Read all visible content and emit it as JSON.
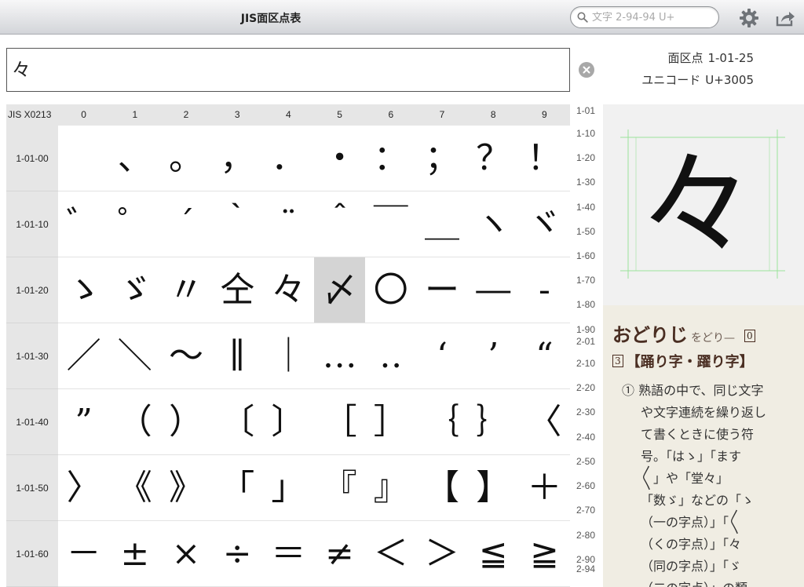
{
  "app": {
    "title": "JIS面区点表"
  },
  "search": {
    "placeholder": "文字 2-94-94 U+"
  },
  "toolbar": {
    "settings_icon": "gear-icon",
    "share_icon": "share-icon"
  },
  "input": {
    "value": "々"
  },
  "info": {
    "kuten_label": "面区点",
    "kuten_value": "1-01-25",
    "unicode_label": "ユニコード",
    "unicode_value": "U+3005"
  },
  "table": {
    "corner": "JIS X0213",
    "columns": [
      "0",
      "1",
      "2",
      "3",
      "4",
      "5",
      "6",
      "7",
      "8",
      "9"
    ],
    "rows": [
      {
        "label": "1-01-00",
        "cells": [
          "",
          "、",
          "。",
          "，",
          "．",
          "・",
          "：",
          "；",
          "？",
          "！"
        ]
      },
      {
        "label": "1-01-10",
        "cells": [
          "゛",
          "゜",
          "´",
          "｀",
          "¨",
          "＾",
          "￣",
          "＿",
          "ヽ",
          "ヾ"
        ]
      },
      {
        "label": "1-01-20",
        "cells": [
          "ゝ",
          "ゞ",
          "〃",
          "仝",
          "々",
          "〆",
          "〇",
          "ー",
          "―",
          "‐"
        ]
      },
      {
        "label": "1-01-30",
        "cells": [
          "／",
          "＼",
          "～",
          "∥",
          "｜",
          "…",
          "‥",
          "‘",
          "’",
          "“"
        ]
      },
      {
        "label": "1-01-40",
        "cells": [
          "”",
          "（",
          "）",
          "〔",
          "〕",
          "［",
          "］",
          "｛",
          "｝",
          "〈"
        ]
      },
      {
        "label": "1-01-50",
        "cells": [
          "〉",
          "《",
          "》",
          "「",
          "」",
          "『",
          "』",
          "【",
          "】",
          "＋"
        ]
      },
      {
        "label": "1-01-60",
        "cells": [
          "－",
          "±",
          "×",
          "÷",
          "＝",
          "≠",
          "＜",
          "＞",
          "≦",
          "≧"
        ]
      }
    ],
    "selected": {
      "row": 2,
      "col": 5
    }
  },
  "index": [
    "1-01",
    "1-10",
    "1-20",
    "1-30",
    "1-40",
    "1-50",
    "1-60",
    "1-70",
    "1-80",
    "1-90",
    "2-01",
    "2-10",
    "2-20",
    "2-30",
    "2-40",
    "2-50",
    "2-60",
    "2-70",
    "2-80",
    "2-90",
    "2-94"
  ],
  "preview": {
    "glyph": "々",
    "guide_color": "#9be39b"
  },
  "dictionary": {
    "headword": "おどりじ",
    "kana": "をどり—",
    "sense_number": "0",
    "kanji_number": "3",
    "kanji": "【踊り字・躍り字】",
    "body_lines": [
      "① 熟語の中で、同じ文字",
      "や文字連続を繰り返し",
      "て書くときに使う符",
      "号。「はゝ」「ます",
      "〳〵」や「堂々」",
      "「数ゞ」などの「ゝ",
      "（一の字点）」「〳〵",
      "（くの字点）」「々",
      "（同の字点）」「ゞ",
      "（二の字点）」の類"
    ]
  }
}
